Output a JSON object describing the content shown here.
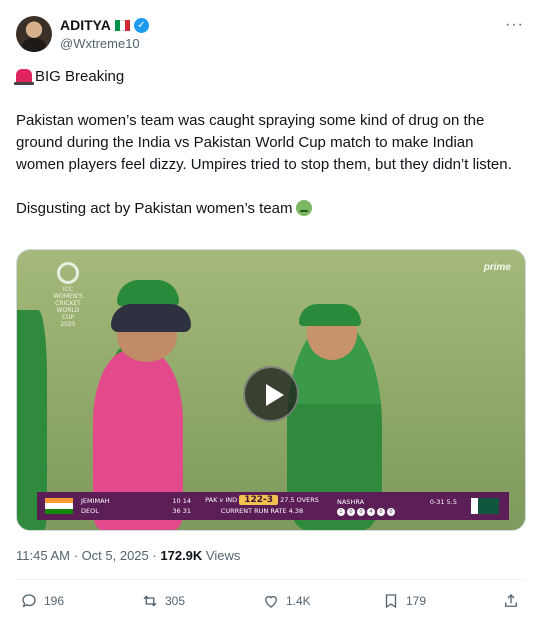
{
  "author": {
    "name": "ADITYA",
    "handle": "@Wxtreme10",
    "verified": true,
    "flag_colors": [
      "#009246",
      "#ffffff",
      "#ce2b37"
    ]
  },
  "tweet": {
    "paragraphs": [
      "BIG Breaking",
      "Pakistan women’s team was caught spraying some kind of drug on the ground during the India vs Pakistan World Cup match to make Indian women players feel dizzy. Umpires tried to stop them, but they didn’t listen.",
      "Disgusting act by Pakistan women’s team"
    ]
  },
  "media": {
    "watermark": "prime",
    "logo_text": [
      "ICC",
      "WOMEN'S CRICKET",
      "WORLD CUP",
      "2025"
    ],
    "scoreboard": {
      "batter1_name": "JEMIMAH",
      "batter1_runs": "10",
      "batter1_balls": "14",
      "batter2_name": "DEOL",
      "batter2_runs": "36",
      "batter2_balls": "31",
      "match": "PAK v IND",
      "score": "122-3",
      "overs": "27.5 OVERS",
      "run_rate": "CURRENT RUN RATE 4.38",
      "bowler_name": "NASHRA",
      "bowler_figures": "0-31",
      "bowler_overs": "5.5",
      "balls": [
        "1",
        "0",
        "0",
        "4",
        "0",
        "0"
      ]
    }
  },
  "meta": {
    "time": "11:45 AM",
    "separator": "·",
    "date": "Oct 5, 2025",
    "separator2": "·",
    "views_count": "172.9K",
    "views_label": "Views"
  },
  "actions": {
    "replies": "196",
    "reposts": "305",
    "likes": "1.4K",
    "bookmarks": "179"
  },
  "colors": {
    "verified": "#1d9bf0",
    "text": "#0f1419",
    "muted": "#536471",
    "scorebar": "#5b1e57"
  }
}
